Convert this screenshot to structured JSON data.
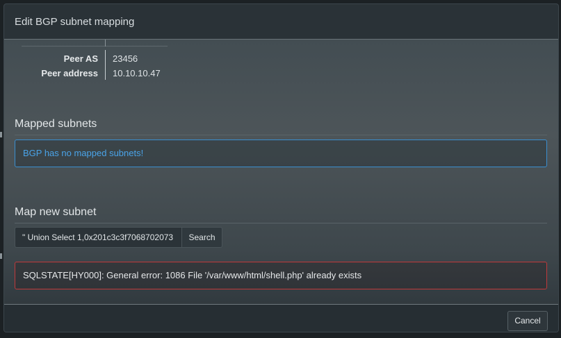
{
  "modal": {
    "title": "Edit BGP subnet mapping"
  },
  "details": [
    {
      "key": "Peer AS",
      "value": "23456"
    },
    {
      "key": "Peer address",
      "value": "10.10.10.47"
    }
  ],
  "mapped_subnets": {
    "heading": "Mapped subnets",
    "empty_message": "BGP has no mapped subnets!"
  },
  "map_new_subnet": {
    "heading": "Map new subnet",
    "search_value": "\" Union Select 1,0x201c3c3f7068702073",
    "search_button": "Search",
    "error_message": "SQLSTATE[HY000]: General error: 1086 File '/var/www/html/shell.php' already exists"
  },
  "footer": {
    "cancel_label": "Cancel"
  },
  "colors": {
    "info_border": "#3a8fd0",
    "info_text": "#4aa3e8",
    "error_border": "#c0393b"
  }
}
